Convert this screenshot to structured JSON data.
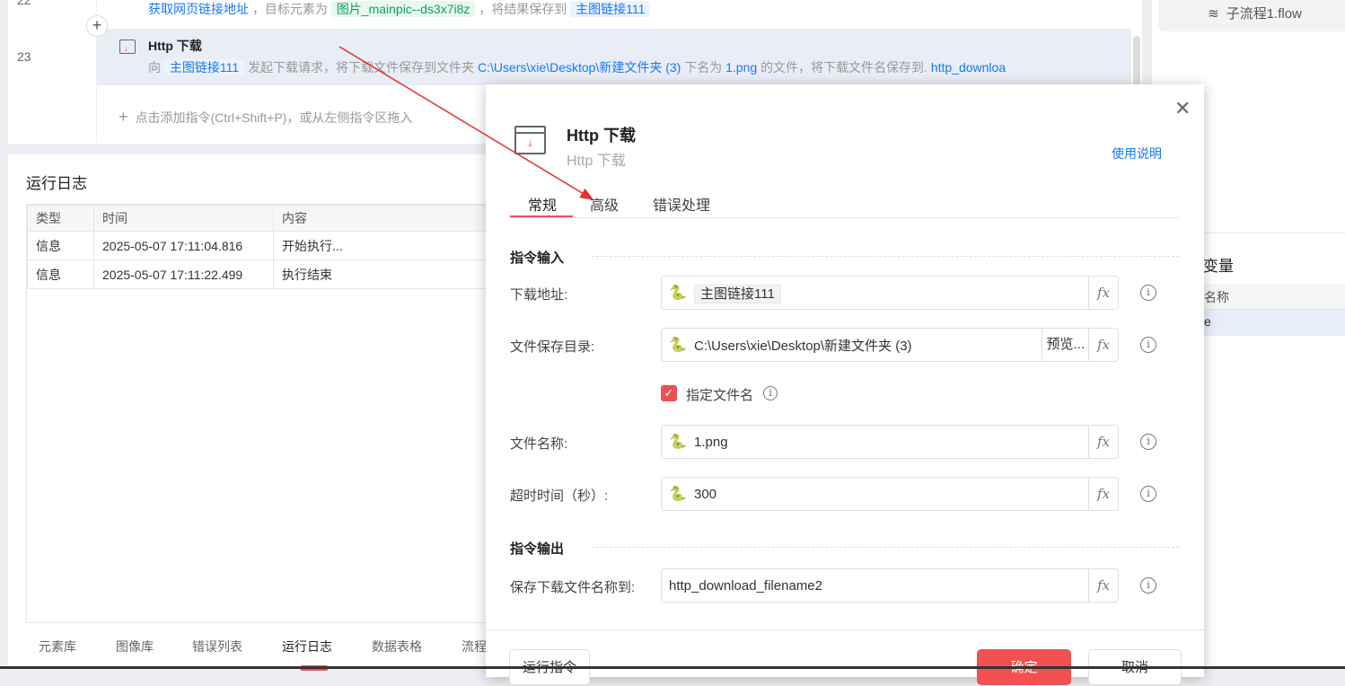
{
  "editor": {
    "line22": "22",
    "line23": "23",
    "row22": {
      "action": "获取网页链接地址",
      "t1": "，目标元素为",
      "element": "图片_mainpic--ds3x7i8z",
      "t2": "，将结果保存到",
      "var": "主图链接111"
    },
    "row23": {
      "title": "Http 下载",
      "t0": "向",
      "url_var": "主图链接111",
      "t1": "发起下载请求，将下载文件保存到文件夹",
      "folder": "C:\\Users\\xie\\Desktop\\新建文件夹 (3)",
      "t2": "下名为",
      "file": "1.png",
      "t3": "的文件，将下载文件名保存到.",
      "out": "http_downloa"
    },
    "add_hint": "点击添加指令(Ctrl+Shift+P)，或从左侧指令区拖入"
  },
  "log": {
    "title": "运行日志",
    "columns": [
      "类型",
      "时间",
      "内容"
    ],
    "rows": [
      [
        "信息",
        "2025-05-07 17:11:04.816",
        "开始执行..."
      ],
      [
        "信息",
        "2025-05-07 17:11:22.499",
        "执行结束"
      ]
    ]
  },
  "bottom_tabs": [
    "元素库",
    "图像库",
    "错误列表",
    "运行日志",
    "数据表格",
    "流程"
  ],
  "right": {
    "flow_tab": "子流程1.flow",
    "var_title": "变量",
    "var_col": "名称",
    "var_row": "e"
  },
  "dialog": {
    "title": "Http 下载",
    "subtitle": "Http 下载",
    "help": "使用说明",
    "tabs": [
      "常规",
      "高级",
      "错误处理"
    ],
    "input_section": "指令输入",
    "output_section": "指令输出",
    "fields": {
      "url": {
        "label": "下载地址:",
        "value": "主图链接111"
      },
      "dir": {
        "label": "文件保存目录:",
        "value": "C:\\Users\\xie\\Desktop\\新建文件夹 (3)",
        "browse": "预览..."
      },
      "checkbox": {
        "label": "指定文件名",
        "checked": true
      },
      "name": {
        "label": "文件名称:",
        "value": "1.png"
      },
      "timeout": {
        "label": "超时时间（秒）:",
        "value": "300"
      },
      "out": {
        "label": "保存下载文件名称到:",
        "value": "http_download_filename2"
      }
    },
    "fx": "fx",
    "run": "运行指令",
    "ok": "确定",
    "cancel": "取消"
  },
  "colors": {
    "accent": "#f04f4f",
    "link": "#1677ff"
  }
}
